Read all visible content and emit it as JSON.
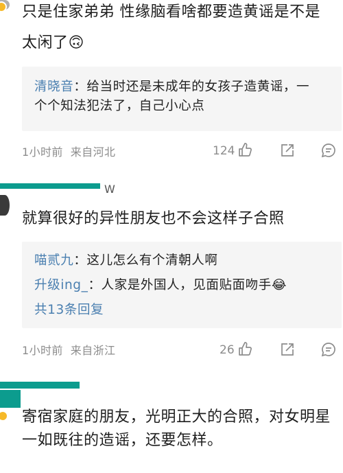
{
  "comments": [
    {
      "text_line1": "只是住家弟弟 性缘脑看啥都要造黄谣是不是",
      "text_line2": "太闲了🙃",
      "replies": [
        {
          "name": "清晓音",
          "sep": "：",
          "text": "给当时还是未成年的女孩子造黄谣，一",
          "cont": "个个知法犯法了，自己小心点"
        }
      ],
      "time": "1小时前",
      "location": "来自河北",
      "likes": "124"
    },
    {
      "username_partial": "W",
      "text": "就算很好的异性朋友也不会这样子合照",
      "replies": [
        {
          "name": "喵贰九",
          "sep": "：",
          "text": "这儿怎么有个清朝人啊"
        },
        {
          "name": "升级ing_",
          "sep": "：",
          "text": "人家是外国人，见面贴面吻手😂"
        }
      ],
      "more_replies": "共13条回复",
      "time": "1小时前",
      "location": "来自浙江",
      "likes": "26"
    },
    {
      "text_line1": "寄宿家庭的朋友，光明正大的合照，对女明星",
      "text_line2": "一如既往的造谣，还要怎样。"
    }
  ],
  "icons": {
    "like": "thumbs-up-icon",
    "share": "share-icon",
    "reply": "comment-icon"
  },
  "colors": {
    "name_blue": "#4a7fb0",
    "meta_gray": "#8c8c8c",
    "reply_bg": "#f5f5f5",
    "redaction_bar": "#0c9c8e"
  }
}
